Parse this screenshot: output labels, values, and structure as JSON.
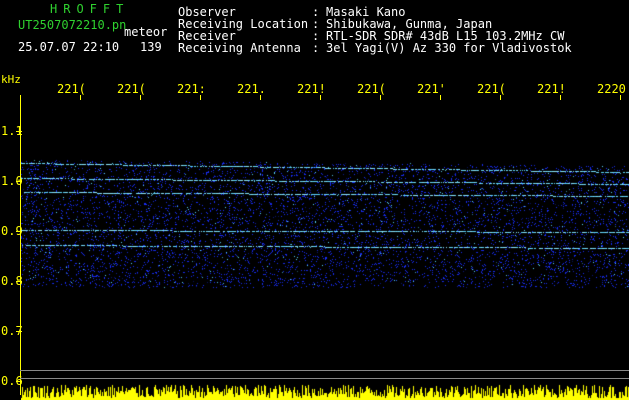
{
  "header": {
    "brand": "HROFFT",
    "file_name": "UT2507072210.pn",
    "file_suffix": "meteor",
    "datetime": "25.07.07 22:10",
    "count": "139",
    "info": [
      {
        "label": "Observer",
        "value": "Masaki Kano"
      },
      {
        "label": "Receiving Location",
        "value": "Shibukawa, Gunma, Japan"
      },
      {
        "label": "Receiver",
        "value": "RTL-SDR SDR# 43dB L15 103.2MHz CW"
      },
      {
        "label": "Receiving Antenna",
        "value": "3el Yagi(V) Az 330 for Vladivostok"
      }
    ],
    "colon": ":"
  },
  "axes": {
    "y_unit": "kHz",
    "y_ticks": [
      "1.1",
      "1.0",
      "0.9",
      "0.8",
      "0.7",
      "0.6"
    ],
    "x_ticks": [
      "221(",
      "221(",
      "221:",
      "221.",
      "221!",
      "221(",
      "221'",
      "221(",
      "221!",
      "2220"
    ]
  },
  "colors": {
    "background": "#000000",
    "text_green": "#2fd12f",
    "axis_yellow": "#ffff00",
    "signal_blue": "#1a2fff",
    "signal_cyan": "#5fd8ff"
  }
}
